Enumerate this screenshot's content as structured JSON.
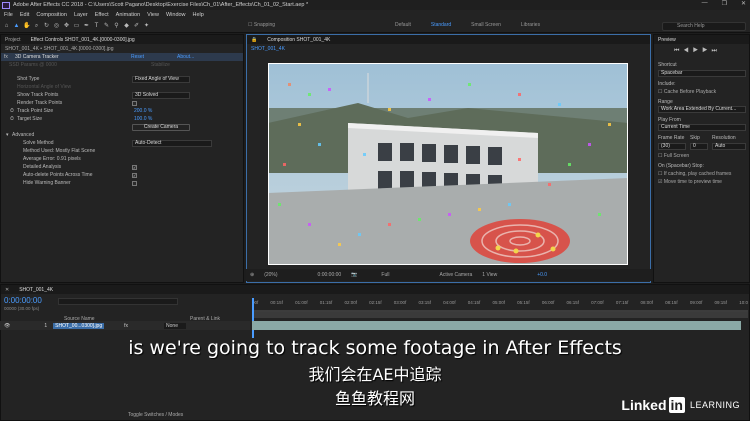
{
  "titlebar": {
    "title": "Adobe After Effects CC 2018 - C:\\Users\\Scott Pagano\\Desktop\\Exercise Files\\Ch_01\\After_Effects\\Ch_01_02_Start.aep *",
    "minimize": "—",
    "maximize": "❐",
    "close": "✕"
  },
  "menu": [
    "File",
    "Edit",
    "Composition",
    "Layer",
    "Effect",
    "Animation",
    "View",
    "Window",
    "Help"
  ],
  "toolbar": {
    "snapping": "Snapping",
    "workspaces": [
      "Default",
      "Standard",
      "Small Screen",
      "Libraries"
    ],
    "active_workspace": "Standard",
    "search_placeholder": "Search Help"
  },
  "left_panel": {
    "tabs": [
      "Project",
      "Effect Controls SHOT_001_4K.[0000-0300].jpg"
    ],
    "header": "SHOT_001_4K • SHOT_001_4K.[0000-0300].jpg",
    "effect_name": "3D Camera Tracker",
    "reset": "Reset",
    "about": "About...",
    "ssd_label": "SSD Params @ 0000",
    "ssd_value": "Stabilize",
    "rows": {
      "shot_type_label": "Shot Type",
      "shot_type_value": "Fixed Angle of View",
      "horizontal_aov_label": "Horizontal Angle of View",
      "show_track_points_label": "Show Track Points",
      "show_track_points_value": "3D Solved",
      "render_track_points_label": "Render Track Points",
      "track_point_size_label": "Track Point Size",
      "track_point_size_value": "200.0 %",
      "target_size_label": "Target Size",
      "target_size_value": "100.0 %",
      "create_camera": "Create Camera",
      "advanced_label": "Advanced",
      "solve_method_label": "Solve Method",
      "solve_method_value": "Auto-Detect",
      "method_used": "Method Used: Mostly Flat Scene",
      "avg_error": "Average Error: 0.91 pixels",
      "detailed_analysis": "Detailed Analysis",
      "auto_delete": "Auto-delete Points Across Time",
      "hide_warning": "Hide Warning Banner"
    }
  },
  "comp_panel": {
    "tab": "Composition SHOT_001_4K",
    "subtab": "SHOT_001_4K",
    "zoom": "(20%)",
    "timecode": "0:00:00:00",
    "resolution": "Full",
    "camera": "Active Camera",
    "views": "1 View",
    "exposure": "+0.0"
  },
  "preview_panel": {
    "title": "Preview",
    "shortcut_label": "Shortcut",
    "shortcut_value": "Spacebar",
    "include_label": "Include:",
    "cache_before": "Cache Before Playback",
    "range_label": "Range",
    "range_value": "Work Area Extended By Current...",
    "play_from_label": "Play From",
    "play_from_value": "Current Time",
    "frame_rate_label": "Frame Rate",
    "skip_label": "Skip",
    "resolution_label": "Resolution",
    "frame_rate_value": "(30)",
    "skip_value": "0",
    "resolution_value": "Auto",
    "full_screen": "Full Screen",
    "stop_label": "On (Spacebar) Stop:",
    "if_caching": "If caching, play cached frames",
    "move_time": "Move time to preview time"
  },
  "timeline": {
    "tab": "SHOT_001_4K",
    "timecode": "0:00:00:00",
    "fps": "00000 (30.00 fps)",
    "col_source": "Source Name",
    "col_parent": "Parent & Link",
    "layer_num": "1",
    "layer_name": "SHOT_00...0300].jpg",
    "parent_value": "None",
    "ruler": [
      "00f",
      "00:15f",
      "01:00f",
      "01:15f",
      "02:00f",
      "02:15f",
      "03:00f",
      "03:15f",
      "04:00f",
      "04:15f",
      "05:00f",
      "05:15f",
      "06:00f",
      "06:15f",
      "07:00f",
      "07:15f",
      "08:00f",
      "08:15f",
      "09:00f",
      "09:15f",
      "10:0"
    ],
    "toggle": "Toggle Switches / Modes"
  },
  "subtitles": {
    "english": "is we're going to track some footage in After Effects",
    "chinese": "我们会在AE中追踪",
    "watermark": "鱼鱼教程网"
  },
  "branding": {
    "linked": "Linked",
    "in": "in",
    "learning": "LEARNING"
  },
  "colors": {
    "accent": "#4a9cff",
    "panel": "#232323",
    "track": "#8aa9a6",
    "target": "#e0443a"
  }
}
